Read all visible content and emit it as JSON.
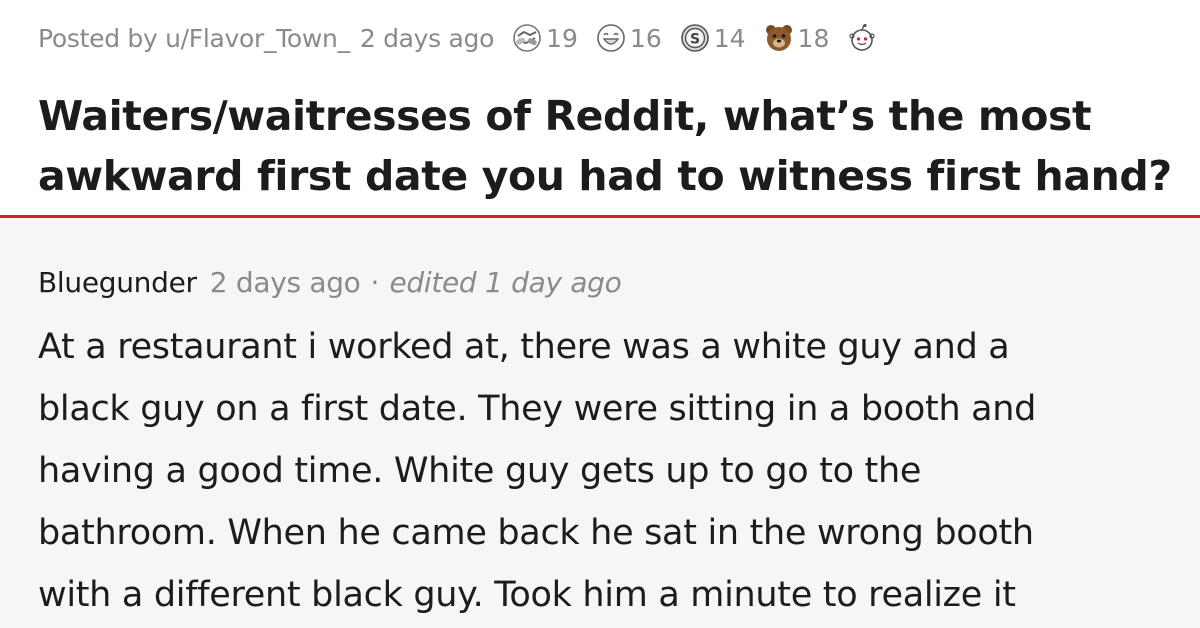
{
  "post": {
    "posted_by": "Posted by u/Flavor_Town_",
    "time": "2 days ago",
    "awards": [
      {
        "icon": "handshake-award-icon",
        "count": "19"
      },
      {
        "icon": "laughing-face-award-icon",
        "count": "16"
      },
      {
        "icon": "silver-coin-award-icon",
        "count": "14"
      },
      {
        "icon": "bear-face-award-icon",
        "count": "18"
      },
      {
        "icon": "add-award-icon"
      }
    ],
    "title_line1": "Waiters/waitresses of Reddit, what’s the most",
    "title_line2": "awkward first date you had to witness first hand?"
  },
  "comment": {
    "author": "Bluegunder",
    "time": "2 days ago",
    "separator": "·",
    "edited": "edited 1 day ago",
    "lines": [
      "At a restaurant i worked at, there was a white guy and a",
      "black guy on a first date. They were sitting in a booth and",
      "having a good time. White guy gets up to go to the",
      "bathroom. When he came back he sat in the wrong booth",
      "with a different black guy. Took him a minute to realize it"
    ]
  },
  "colors": {
    "accent_divider": "#e1192b",
    "meta_text": "#8a8a8a",
    "body_text": "#1c1c1c",
    "comment_background": "#f6f6f6"
  }
}
